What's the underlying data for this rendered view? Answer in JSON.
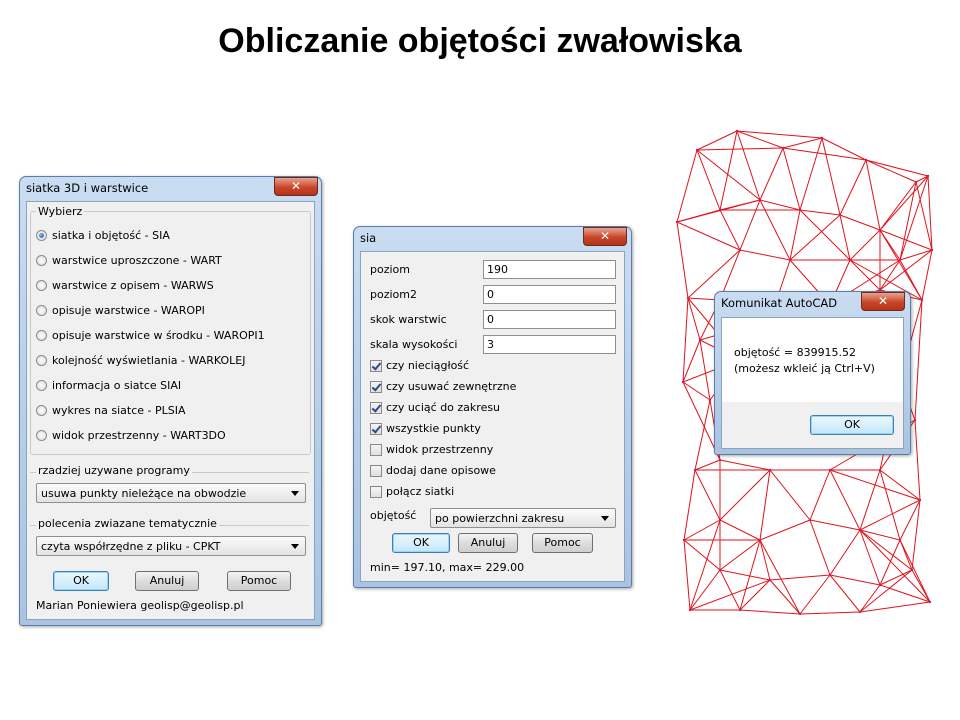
{
  "slide": {
    "title": "Obliczanie objętości zwałowiska"
  },
  "win1": {
    "title": "siatka 3D i warstwice",
    "close": "✕",
    "group_title": "Wybierz",
    "options": [
      {
        "label": "siatka i objętość - SIA",
        "selected": true
      },
      {
        "label": "warstwice uproszczone - WART",
        "selected": false
      },
      {
        "label": "warstwice z opisem - WARWS",
        "selected": false
      },
      {
        "label": "opisuje warstwice - WAROPI",
        "selected": false
      },
      {
        "label": "opisuje warstwice w środku - WAROPI1",
        "selected": false
      },
      {
        "label": "kolejność wyświetlania - WARKOLEJ",
        "selected": false
      },
      {
        "label": "informacja o siatce SIAI",
        "selected": false
      },
      {
        "label": "wykres na siatce - PLSIA",
        "selected": false
      },
      {
        "label": "widok przestrzenny - WART3DO",
        "selected": false
      }
    ],
    "section1_label": "rzadziej uzywane programy",
    "combo1_value": "usuwa punkty nieleżące na obwodzie",
    "section2_label": "polecenia zwiazane tematycznie",
    "combo2_value": "czyta współrzędne z pliku - CPKT",
    "ok": "OK",
    "cancel": "Anuluj",
    "help": "Pomoc",
    "footer": "Marian Poniewiera geolisp@geolisp.pl"
  },
  "win2": {
    "title": "sia",
    "close": "✕",
    "fields": [
      {
        "label": "poziom",
        "value": "190"
      },
      {
        "label": "poziom2",
        "value": "0"
      },
      {
        "label": "skok warstwic",
        "value": "0"
      },
      {
        "label": "skala wysokości",
        "value": "3"
      }
    ],
    "checks": [
      {
        "label": "czy nieciągłość",
        "checked": true
      },
      {
        "label": "czy usuwać zewnętrzne",
        "checked": true
      },
      {
        "label": "czy uciąć do zakresu",
        "checked": true
      },
      {
        "label": "wszystkie punkty",
        "checked": true
      },
      {
        "label": "widok przestrzenny",
        "checked": false
      },
      {
        "label": "dodaj dane opisowe",
        "checked": false
      },
      {
        "label": "połącz siatki",
        "checked": false
      }
    ],
    "volume_label": "objętość",
    "volume_value": "po powierzchni zakresu",
    "ok": "OK",
    "cancel": "Anuluj",
    "help": "Pomoc",
    "status": "min= 197.10, max= 229.00"
  },
  "win3": {
    "title": "Komunikat AutoCAD",
    "close": "✕",
    "line1": "objętość = 839915.52",
    "line2": "(możesz wkleić ją Ctrl+V)",
    "ok": "OK"
  },
  "colors": {
    "mesh": "#e0131a",
    "mesh_points": "#c02070"
  }
}
